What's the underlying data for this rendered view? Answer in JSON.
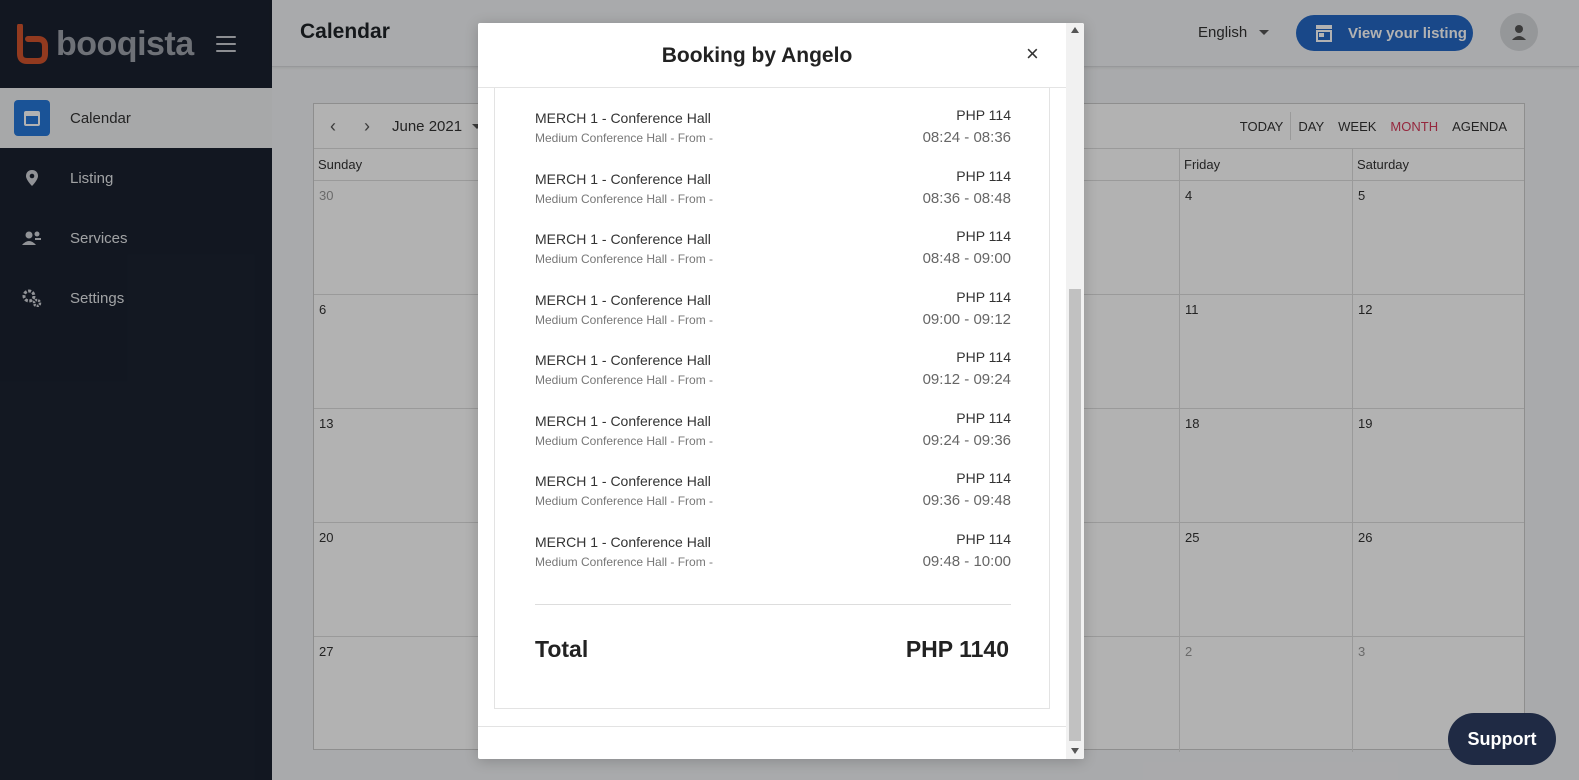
{
  "brand": {
    "name": "booqista"
  },
  "sidebar": {
    "items": [
      {
        "label": "Calendar",
        "icon": "calendar-icon",
        "active": true
      },
      {
        "label": "Listing",
        "icon": "map-pin-icon"
      },
      {
        "label": "Services",
        "icon": "people-icon"
      },
      {
        "label": "Settings",
        "icon": "gears-icon"
      }
    ]
  },
  "topbar": {
    "title": "Calendar",
    "language": "English",
    "view_listing": "View your listing"
  },
  "calendar": {
    "month": "June 2021",
    "views": [
      "TODAY",
      "DAY",
      "WEEK",
      "MONTH",
      "AGENDA"
    ],
    "active_view": "MONTH",
    "days": [
      "Sunday",
      "Friday",
      "Saturday"
    ],
    "dates": {
      "sun": [
        "30",
        "6",
        "13",
        "20",
        "27"
      ],
      "fri": [
        "4",
        "11",
        "18",
        "25",
        "2"
      ],
      "sat": [
        "5",
        "12",
        "19",
        "26",
        "3"
      ]
    }
  },
  "modal": {
    "title": "Booking by Angelo",
    "items": [
      {
        "name": "MERCH 1 - Conference Hall",
        "sub": "Medium Conference Hall - From -",
        "price": "PHP 114",
        "time": "08:24 - 08:36"
      },
      {
        "name": "MERCH 1 - Conference Hall",
        "sub": "Medium Conference Hall - From -",
        "price": "PHP 114",
        "time": "08:36 - 08:48"
      },
      {
        "name": "MERCH 1 - Conference Hall",
        "sub": "Medium Conference Hall - From -",
        "price": "PHP 114",
        "time": "08:48 - 09:00"
      },
      {
        "name": "MERCH 1 - Conference Hall",
        "sub": "Medium Conference Hall - From -",
        "price": "PHP 114",
        "time": "09:00 - 09:12"
      },
      {
        "name": "MERCH 1 - Conference Hall",
        "sub": "Medium Conference Hall - From -",
        "price": "PHP 114",
        "time": "09:12 - 09:24"
      },
      {
        "name": "MERCH 1 - Conference Hall",
        "sub": "Medium Conference Hall - From -",
        "price": "PHP 114",
        "time": "09:24 - 09:36"
      },
      {
        "name": "MERCH 1 - Conference Hall",
        "sub": "Medium Conference Hall - From -",
        "price": "PHP 114",
        "time": "09:36 - 09:48"
      },
      {
        "name": "MERCH 1 - Conference Hall",
        "sub": "Medium Conference Hall - From -",
        "price": "PHP 114",
        "time": "09:48 - 10:00"
      }
    ],
    "total_label": "Total",
    "total_value": "PHP 1140"
  },
  "support": "Support",
  "colors": {
    "sidebar": "#1b2230",
    "accent": "#2468c4",
    "active_view": "#d63a5a"
  }
}
